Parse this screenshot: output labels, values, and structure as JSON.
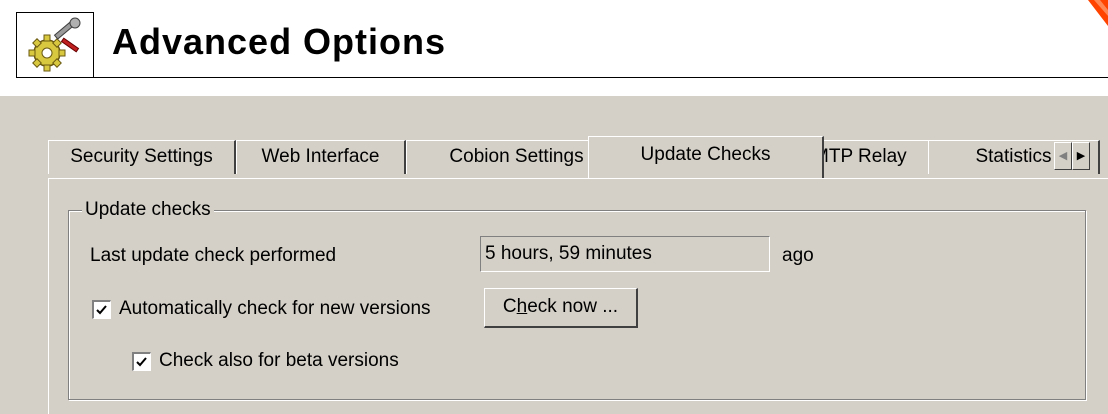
{
  "header": {
    "title": "Advanced Options",
    "icon": "tools-gear-icon"
  },
  "tabs": [
    {
      "label": "Security Settings",
      "active": false
    },
    {
      "label": "Web Interface",
      "active": false
    },
    {
      "label": "Cobion Settings",
      "active": false
    },
    {
      "label": "Update Checks",
      "active": true
    },
    {
      "label": "SMTP Relay",
      "active": false
    },
    {
      "label": "Statistics",
      "active": false
    }
  ],
  "tab_scroll": {
    "left_icon": "arrow-left-icon",
    "right_icon": "arrow-right-icon"
  },
  "update_checks": {
    "group_title": "Update checks",
    "last_check_label": "Last update check performed",
    "last_check_value": "5 hours, 59 minutes",
    "last_check_suffix": "ago",
    "auto_check_label": "Automatically check for new versions",
    "auto_check_checked": true,
    "check_now_label_prefix": "C",
    "check_now_label_mnemonic": "h",
    "check_now_label_suffix": "eck now ...",
    "beta_check_label": "Check also for beta versions",
    "beta_check_checked": true
  },
  "colors": {
    "dialog_background": "#d4d0c8",
    "accent_corner": "#ff4400"
  }
}
